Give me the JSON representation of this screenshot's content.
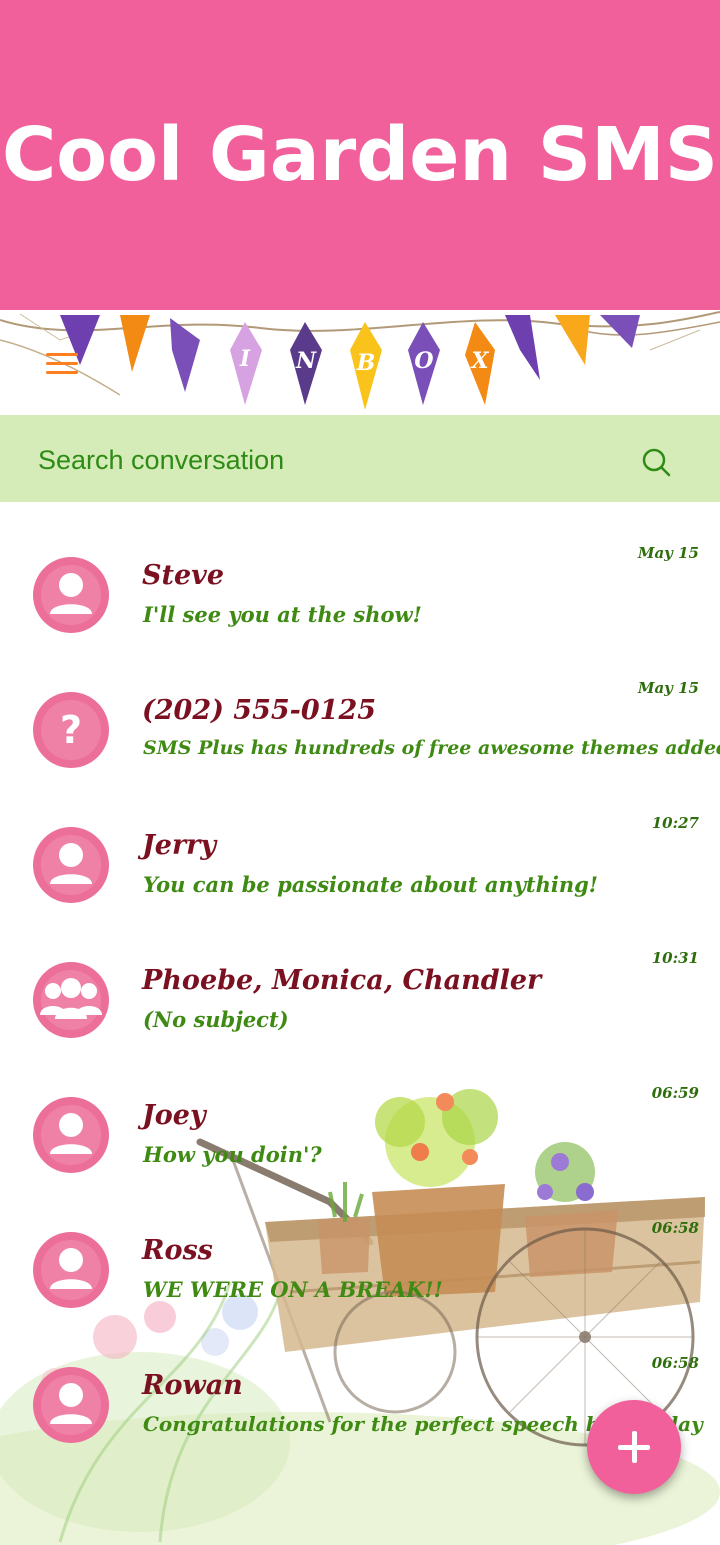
{
  "banner": {
    "title": "Cool Garden SMS"
  },
  "header": {
    "letters": [
      "I",
      "N",
      "B",
      "O",
      "X"
    ]
  },
  "search": {
    "placeholder": "Search conversation"
  },
  "conversations": [
    {
      "name": "Steve",
      "snippet": "I'll see you at the show!",
      "time": "May 15",
      "avatar": "person-icon"
    },
    {
      "name": "(202) 555-0125",
      "snippet": "SMS Plus has hundreds of free awesome themes added daily",
      "time": "May 15",
      "avatar": "unknown-contact-icon"
    },
    {
      "name": "Jerry",
      "snippet": " You can be passionate about anything!",
      "time": "10:27",
      "avatar": "person-icon"
    },
    {
      "name": "Phoebe, Monica, Chandler",
      "snippet": "(No subject)",
      "time": "10:31",
      "avatar": "group-icon"
    },
    {
      "name": "Joey",
      "snippet": "How you doin'?",
      "time": "06:59",
      "avatar": "person-icon"
    },
    {
      "name": "Ross",
      "snippet": "WE WERE ON A BREAK!!",
      "time": "06:58",
      "avatar": "person-icon"
    },
    {
      "name": "Rowan",
      "snippet": "Congratulations for the perfect speech held today",
      "time": "06:58",
      "avatar": "person-icon"
    }
  ],
  "colors": {
    "banner": "#f2609b",
    "search_bg": "#d6ecb8",
    "name": "#7a1020",
    "snippet": "#3e8a12",
    "fab": "#f2609b"
  }
}
